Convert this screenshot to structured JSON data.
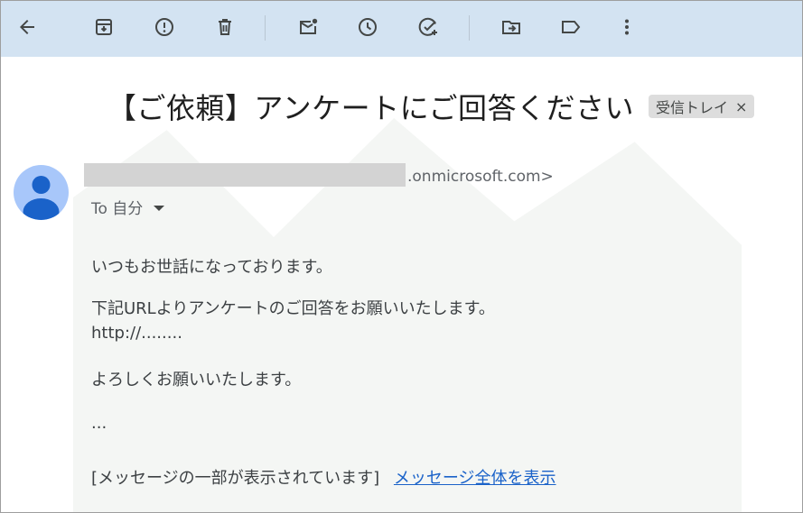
{
  "toolbar": {
    "buttons": [
      {
        "name": "back",
        "icon": "arrow-left-icon"
      },
      {
        "name": "archive",
        "icon": "archive-icon"
      },
      {
        "name": "report-spam",
        "icon": "report-spam-icon"
      },
      {
        "name": "delete",
        "icon": "trash-icon"
      },
      {
        "name": "mark-unread",
        "icon": "mail-unread-icon"
      },
      {
        "name": "snooze",
        "icon": "clock-icon"
      },
      {
        "name": "add-task",
        "icon": "add-task-icon"
      },
      {
        "name": "move-to",
        "icon": "move-folder-icon"
      },
      {
        "name": "labels",
        "icon": "label-icon"
      },
      {
        "name": "more",
        "icon": "more-vertical-icon"
      }
    ],
    "background": "#d3e3f2"
  },
  "message": {
    "subject": "【ご依頼】アンケートにご回答ください",
    "label_chip": "受信トレイ",
    "label_chip_close": "×",
    "sender_visible_suffix": ".onmicrosoft.com>",
    "to_label": "To 自分",
    "body": {
      "line1": "いつもお世話になっております。",
      "line2": "下記URLよりアンケートのご回答をお願いいたします。",
      "line3": "http://........",
      "line4": "よろしくお願いいたします。",
      "line5": "...",
      "clipped_notice": "[メッセージの一部が表示されています]",
      "view_entire_link": "メッセージ全体を表示"
    }
  },
  "colors": {
    "avatar_bg": "#a8c7fa",
    "avatar_fg": "#1a62c9",
    "link": "#1a62c9",
    "redacted_bar": "#d3d3d3"
  }
}
